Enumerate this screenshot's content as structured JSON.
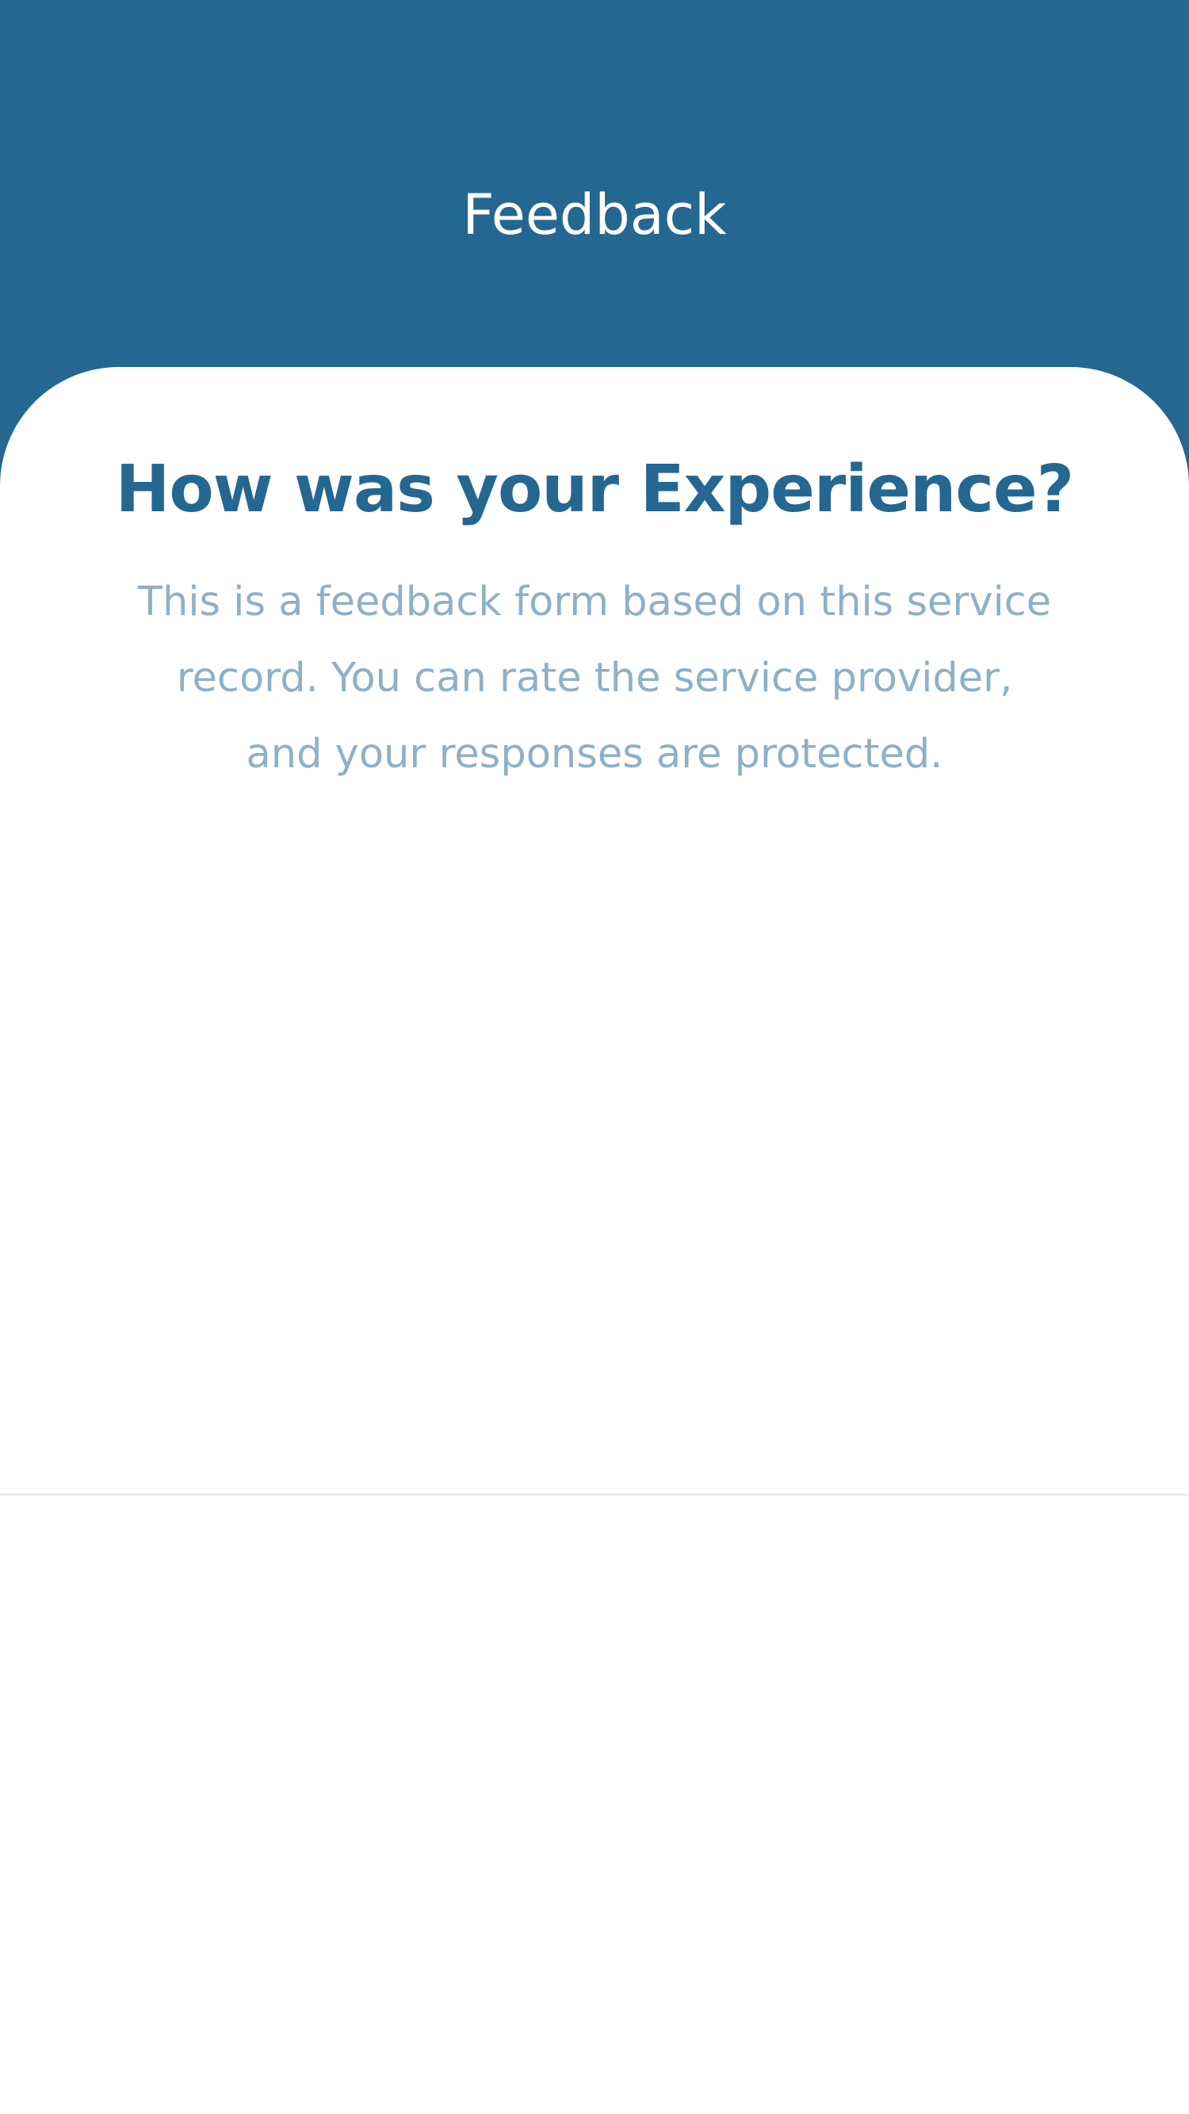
{
  "header": {
    "title": "Feedback"
  },
  "card": {
    "heading": "How was your Experience?",
    "description": "This is a feedback form based on this service record. You can rate the service provider, and your responses are protected."
  },
  "colors": {
    "header_bg": "#246791",
    "heading": "#246791",
    "description": "#8fb0c7",
    "card_bg": "#ffffff",
    "divider": "#e6ecef"
  }
}
